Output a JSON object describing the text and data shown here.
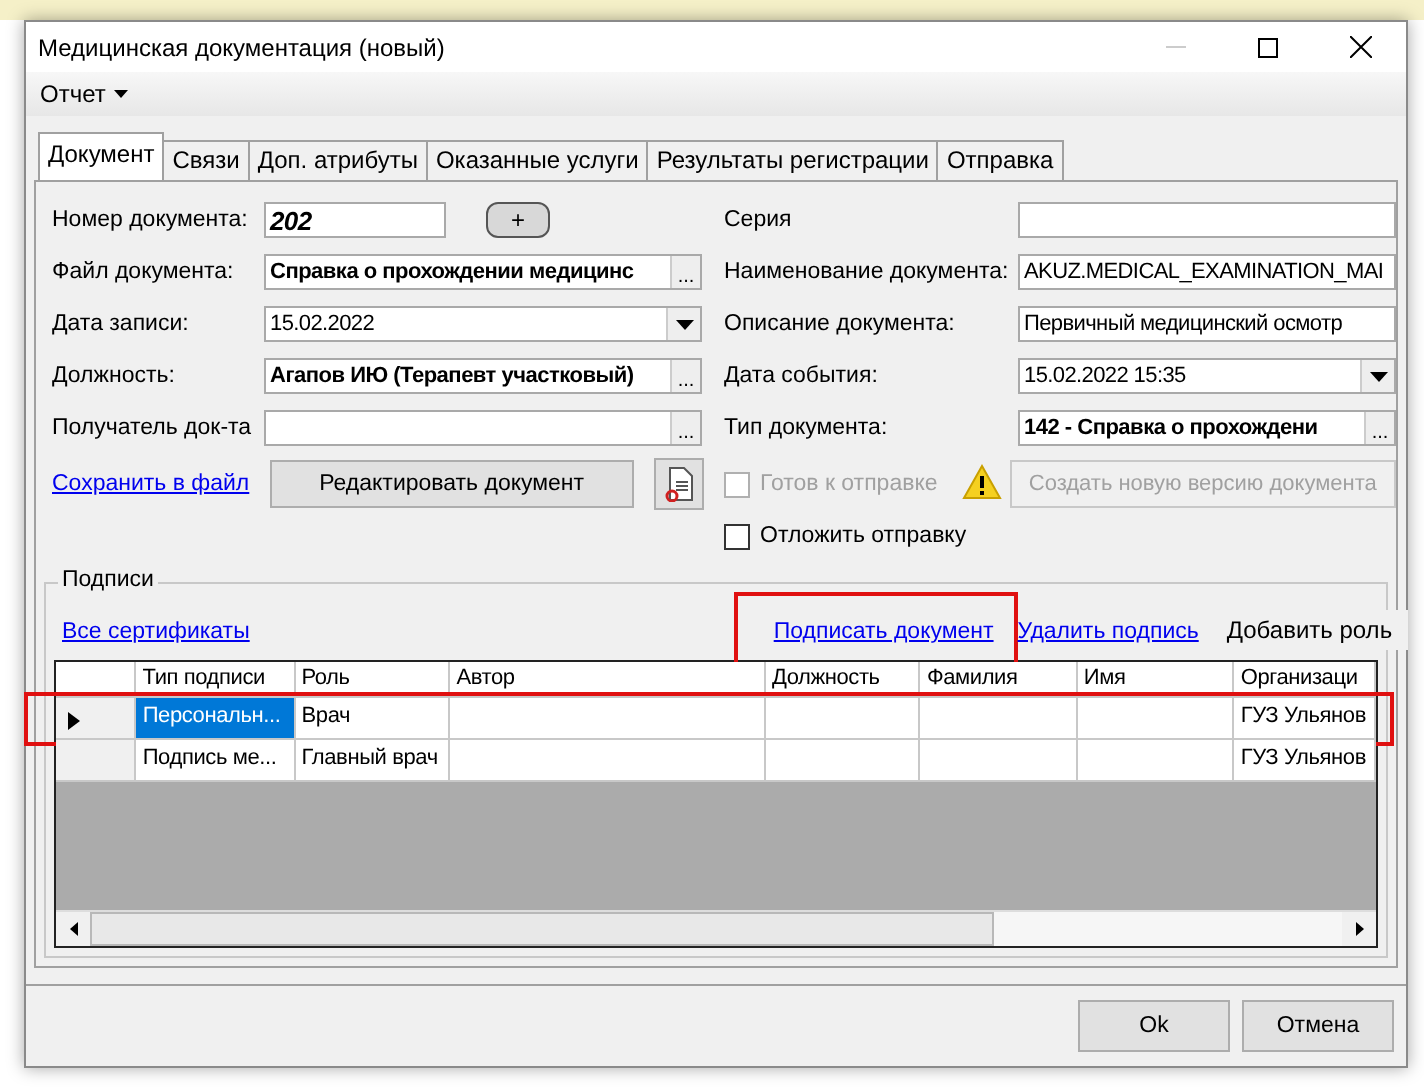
{
  "window": {
    "title": "Медицинская документация (новый)"
  },
  "menu": [
    {
      "label": "Отчет"
    }
  ],
  "tabs": [
    {
      "label": "Документ",
      "selected": true
    },
    {
      "label": "Связи",
      "selected": false
    },
    {
      "label": "Доп. атрибуты",
      "selected": false
    },
    {
      "label": "Оказанные услуги",
      "selected": false
    },
    {
      "label": "Результаты регистрации",
      "selected": false
    },
    {
      "label": "Отправка",
      "selected": false
    }
  ],
  "fields_left": [
    {
      "label": "Номер документа:",
      "value": "202",
      "kind": "number",
      "button_label": "+"
    },
    {
      "label": "Файл документа:",
      "value": "Справка о прохождении медицинс",
      "kind": "picker",
      "button_label": "..."
    },
    {
      "label": "Дата записи:",
      "value": "15.02.2022",
      "kind": "dropdown"
    },
    {
      "label": "Должность:",
      "value": "Агапов ИЮ (Терапевт участковый)",
      "kind": "picker",
      "button_label": "..."
    },
    {
      "label": "Получатель док-та",
      "kind": "picker",
      "button_label": "..."
    }
  ],
  "fields_right": [
    {
      "label": "Серия",
      "kind": "text"
    },
    {
      "label": "Наименование документа:",
      "value": "AKUZ.MEDICAL_EXAMINATION_MAI",
      "kind": "text"
    },
    {
      "label": "Описание документа:",
      "value": "Первичный медицинский осмотр",
      "kind": "text"
    },
    {
      "label": "Дата события:",
      "value": "15.02.2022 15:35",
      "kind": "dropdown"
    },
    {
      "label": "Тип документа:",
      "value": "142 - Справка о прохождени",
      "kind": "picker",
      "button_label": "..."
    }
  ],
  "save_link": "Сохранить в файл",
  "edit_button": "Редактировать документ",
  "checkboxes": [
    {
      "label": "Готов к отправке",
      "checked": false,
      "disabled": true
    },
    {
      "label": "Отложить отправку",
      "checked": false,
      "disabled": false
    }
  ],
  "new_version_button": {
    "label": "Создать новую версию документа",
    "disabled": true
  },
  "signatures": {
    "title": "Подписи",
    "actions": [
      {
        "label": "Все сертификаты",
        "kind": "link",
        "highlighted": false
      },
      {
        "label": "Подписать документ",
        "kind": "link",
        "highlighted": true
      },
      {
        "label": "Удалить подпись",
        "kind": "link",
        "highlighted": false
      },
      {
        "label": "Добавить роль",
        "kind": "button",
        "highlighted": false
      }
    ],
    "table": {
      "columns": [
        "Тип подписи",
        "Роль",
        "Автор",
        "Должность",
        "Фамилия",
        "Имя",
        "Организаци"
      ],
      "rows": [
        {
          "cells": [
            "Персональн...",
            "Врач",
            "",
            "",
            "",
            "",
            "ГУЗ Ульянов"
          ],
          "selected": true,
          "highlighted": true
        },
        {
          "cells": [
            "Подпись ме...",
            "Главный врач",
            "",
            "",
            "",
            "",
            "ГУЗ Ульянов"
          ],
          "selected": false,
          "highlighted": false
        }
      ]
    }
  },
  "buttons": [
    "Ok",
    "Отмена"
  ]
}
